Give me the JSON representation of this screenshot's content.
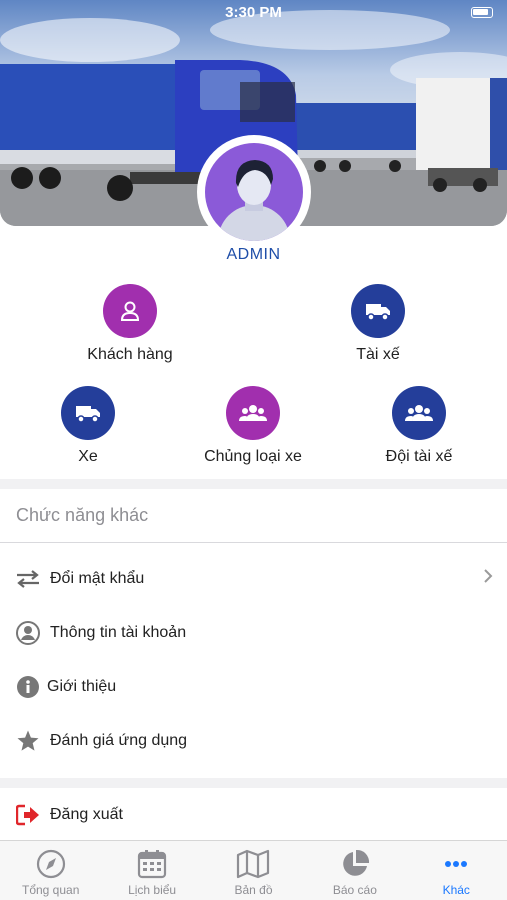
{
  "status_bar": {
    "time": "3:30 PM"
  },
  "profile": {
    "name": "ADMIN"
  },
  "features": [
    {
      "label": "Khách hàng",
      "icon": "user-icon",
      "color": "#a12fae"
    },
    {
      "label": "Tài xế",
      "icon": "truck-icon",
      "color": "#243e9a"
    },
    {
      "label": "Xe",
      "icon": "truck-icon",
      "color": "#243e9a"
    },
    {
      "label": "Chủng loại xe",
      "icon": "group-icon",
      "color": "#a12fae"
    },
    {
      "label": "Đội tài xế",
      "icon": "group-icon",
      "color": "#243e9a"
    }
  ],
  "other_section": {
    "title": "Chức năng khác",
    "items": [
      {
        "label": "Đổi mật khẩu",
        "icon": "swap-arrows-icon"
      },
      {
        "label": "Thông tin tài khoản",
        "icon": "account-circle-icon"
      },
      {
        "label": "Giới thiệu",
        "icon": "info-icon"
      },
      {
        "label": "Đánh giá ứng dụng",
        "icon": "star-icon"
      }
    ]
  },
  "logout": {
    "label": "Đăng xuất",
    "icon": "logout-icon",
    "color": "#e0262b"
  },
  "tabs": [
    {
      "label": "Tổng quan",
      "icon": "compass-icon"
    },
    {
      "label": "Lịch biểu",
      "icon": "calendar-icon"
    },
    {
      "label": "Bản đồ",
      "icon": "map-icon"
    },
    {
      "label": "Báo cáo",
      "icon": "pie-chart-icon"
    },
    {
      "label": "Khác",
      "icon": "more-dots-icon",
      "active": true
    }
  ],
  "colors": {
    "accent": "#1a78ff",
    "admin_text": "#1f4ea8"
  }
}
